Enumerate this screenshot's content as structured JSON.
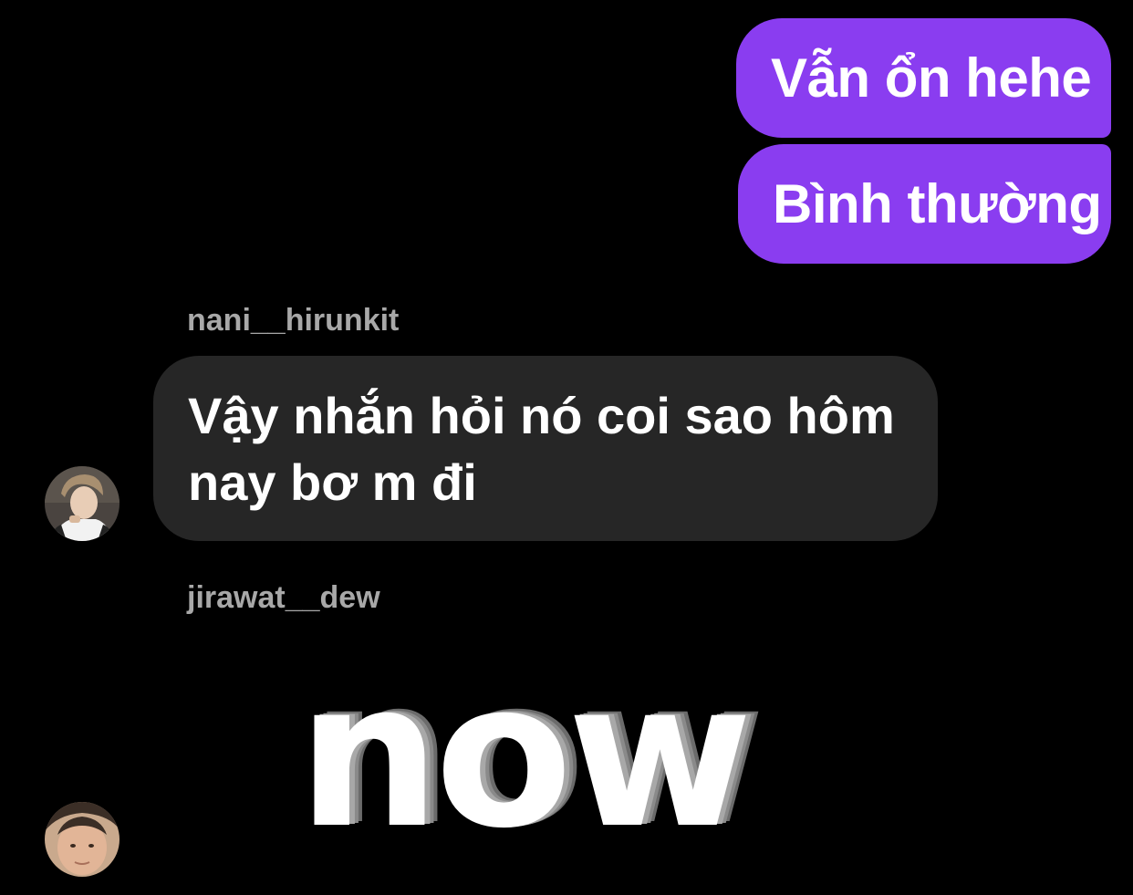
{
  "conversation": {
    "outgoing": [
      {
        "text": "Vẫn ổn hehe"
      },
      {
        "text": "Bình thường"
      }
    ],
    "incoming": [
      {
        "username": "nani__hirunkit",
        "lines": [
          "Vậy nhắn hỏi nó coi sao hôm",
          "nay bơ m đi"
        ]
      },
      {
        "username": "jirawat__dew",
        "sticker_text": "now"
      }
    ]
  },
  "colors": {
    "background": "#000000",
    "outgoing_bubble": "#8a3df0",
    "incoming_bubble": "#262626",
    "username": "#a8a8a8"
  },
  "icons": [
    "avatar-nani",
    "avatar-jirawat"
  ]
}
